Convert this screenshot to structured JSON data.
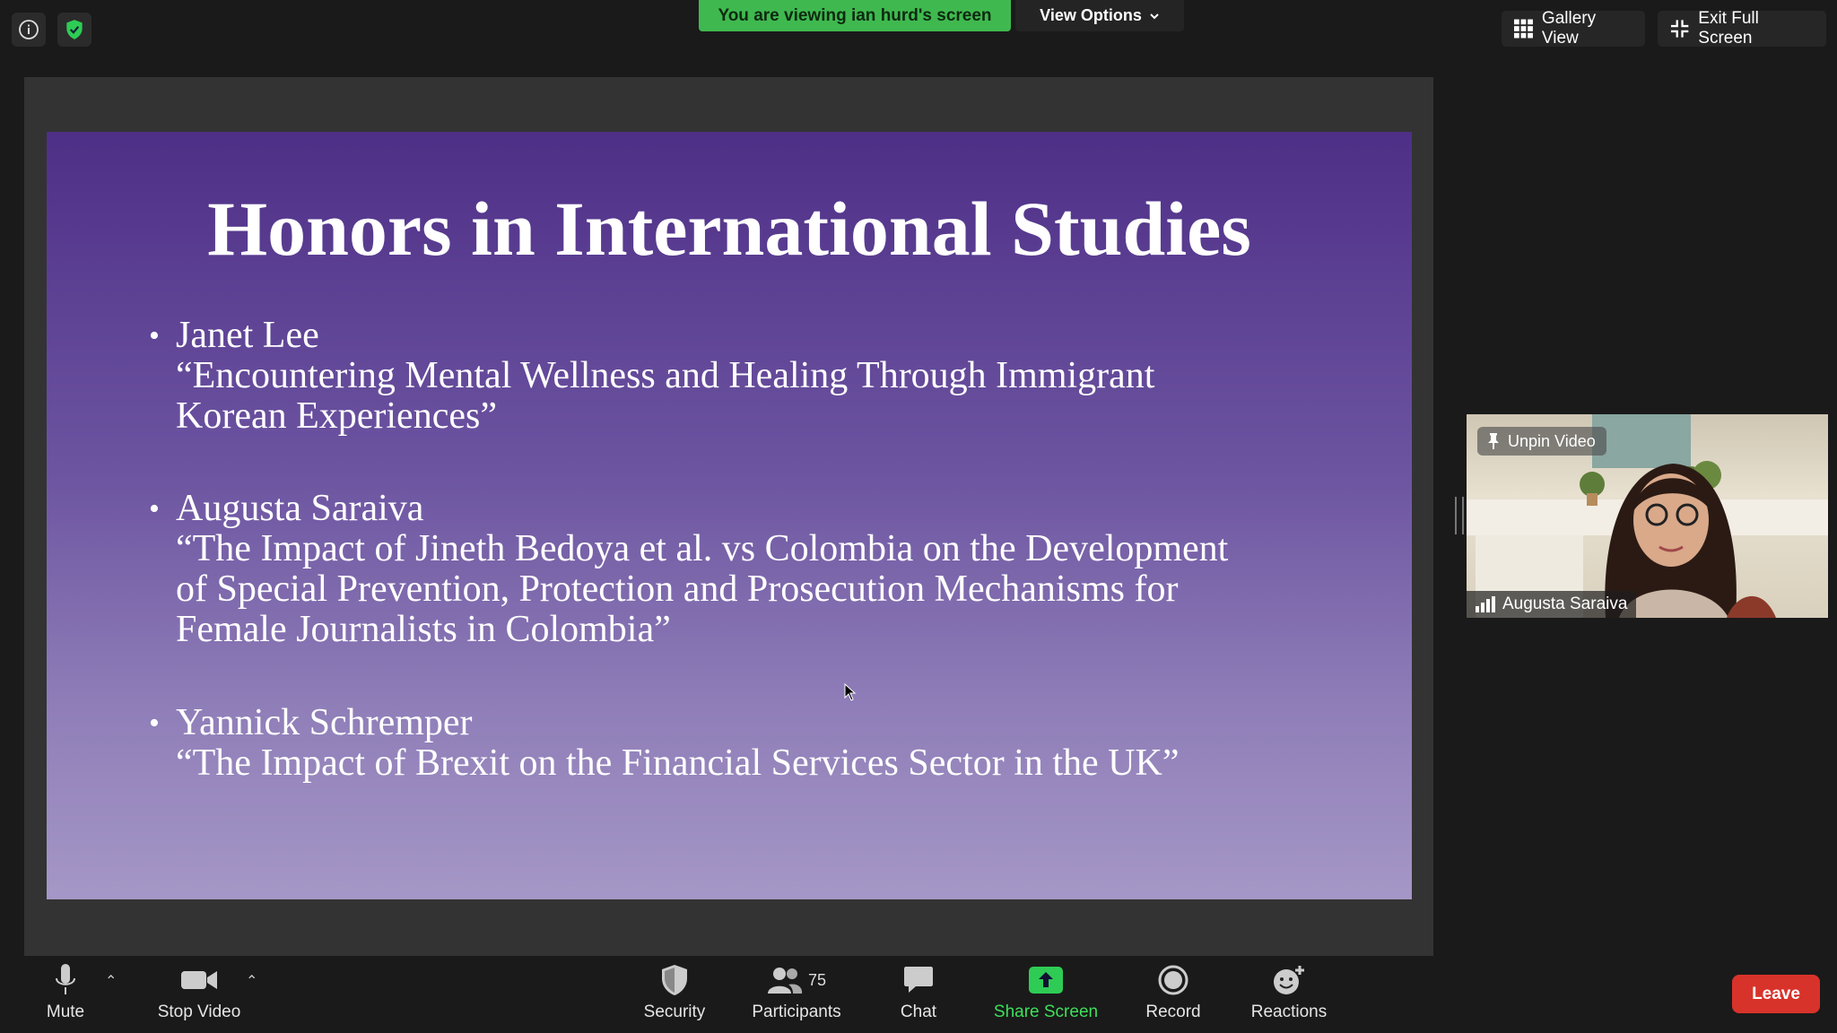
{
  "top_bar": {
    "banner": "You are viewing ian hurd's screen",
    "view_options": "View Options",
    "gallery_view": "Gallery View",
    "exit_full_screen": "Exit Full Screen"
  },
  "slide": {
    "title": "Honors in International Studies",
    "items": [
      {
        "name": "Janet Lee",
        "thesis": "“Encountering Mental Wellness and Healing Through Immigrant Korean Experiences”",
        "thesis_lines": [
          "“Encountering Mental Wellness and Healing Through Immigrant",
          "Korean Experiences”"
        ]
      },
      {
        "name": "Augusta Saraiva",
        "thesis": "“The Impact of Jineth Bedoya et al. vs Colombia on the Development of Special Prevention, Protection and Prosecution Mechanisms for Female Journalists in Colombia”",
        "thesis_lines": [
          "“The Impact of Jineth Bedoya et al. vs Colombia on the Development",
          "of Special Prevention, Protection and Prosecution Mechanisms for",
          "Female Journalists in Colombia”"
        ]
      },
      {
        "name": "Yannick Schremper",
        "thesis": "“The Impact of Brexit on the Financial Services Sector in the UK”",
        "thesis_lines": [
          "“The Impact of Brexit on the Financial Services Sector in the UK”"
        ]
      }
    ]
  },
  "video": {
    "unpin_label": "Unpin Video",
    "participant_name": "Augusta Saraiva"
  },
  "toolbar": {
    "mute": "Mute",
    "stop_video": "Stop Video",
    "security": "Security",
    "participants": "Participants",
    "participants_count": "75",
    "chat": "Chat",
    "share_screen": "Share Screen",
    "record": "Record",
    "reactions": "Reactions",
    "leave": "Leave"
  },
  "colors": {
    "banner_green": "#3fb94f",
    "share_green": "#3ee05a",
    "leave_red": "#d8332b",
    "slide_top": "#4e2f87",
    "slide_bottom": "#a597c6"
  }
}
